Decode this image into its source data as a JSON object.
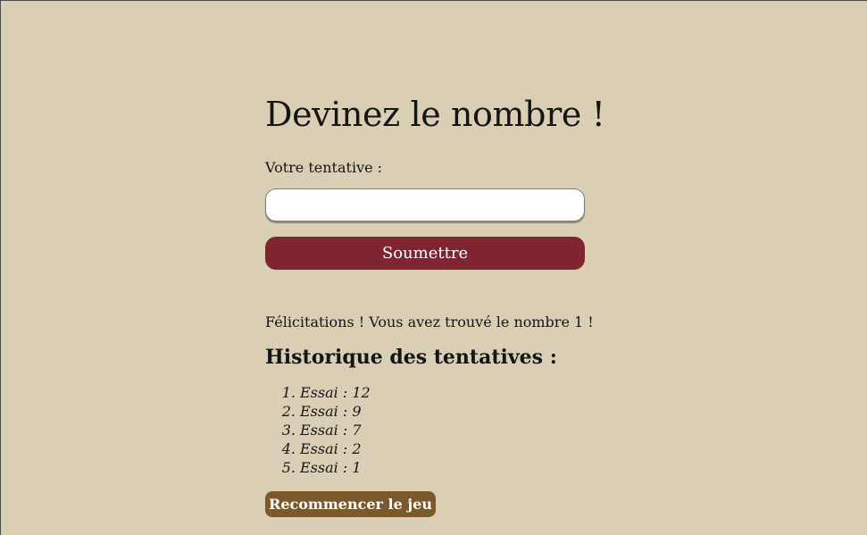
{
  "page": {
    "title": "Devinez le nombre !"
  },
  "form": {
    "label": "Votre tentative :",
    "input_value": "",
    "input_placeholder": "",
    "submit_label": "Soumettre"
  },
  "feedback": {
    "message": "Félicitations ! Vous avez trouvé le nombre 1 !"
  },
  "history": {
    "title": "Historique des tentatives :",
    "items": [
      {
        "num": "1.",
        "text": "Essai : 12"
      },
      {
        "num": "2.",
        "text": "Essai : 9"
      },
      {
        "num": "3.",
        "text": "Essai : 7"
      },
      {
        "num": "4.",
        "text": "Essai : 2"
      },
      {
        "num": "5.",
        "text": "Essai : 1"
      }
    ]
  },
  "actions": {
    "restart_label": "Recommencer le jeu"
  },
  "colors": {
    "background": "#dacfb4",
    "submit_button": "#7f2531",
    "restart_button": "#7a5a2b"
  }
}
